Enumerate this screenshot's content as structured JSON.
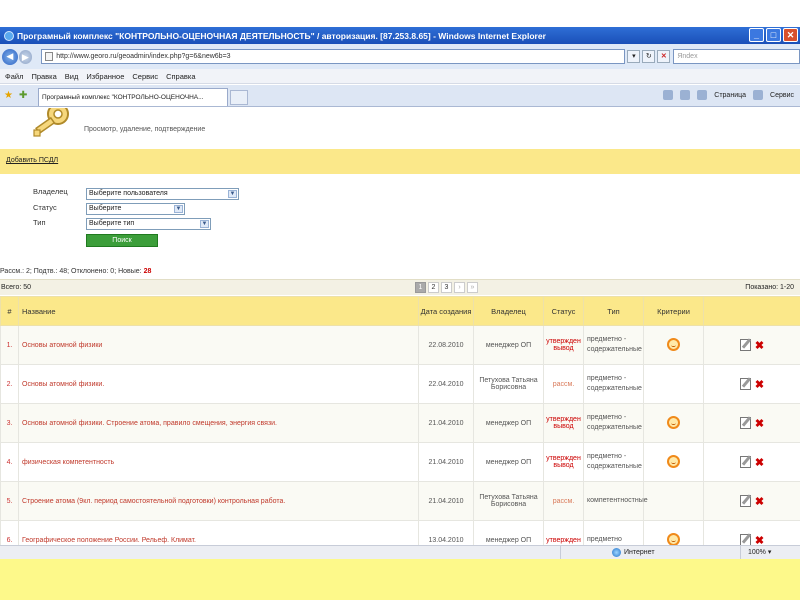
{
  "window": {
    "title": "Програмный комплекс \"КОНТРОЛЬНО-ОЦЕНОЧНАЯ ДЕЯТЕЛЬНОСТЬ\" / авторизация. [87.253.8.65] - Windows Internet Explorer",
    "minimize_label": "_",
    "maximize_label": "□",
    "close_label": "✕"
  },
  "address": {
    "url": "http://www.georo.ru/geoadmin/index.php?g=6&new6b=3",
    "search_placeholder": "Яndex",
    "go_label": "↻",
    "stop_label": "✕"
  },
  "menu": [
    "Файл",
    "Правка",
    "Вид",
    "Избранное",
    "Сервис",
    "Справка"
  ],
  "tab": {
    "label": "Програмный комплекс \"КОНТРОЛЬНО-ОЦЕНОЧНА..."
  },
  "toolbar": {
    "page_label": "Страница",
    "service_label": "Сервис"
  },
  "page": {
    "subtitle": "Просмотр, удаление, подтверждение",
    "add_link": "Добавить ПСДЛ",
    "filters": {
      "owner_label": "Владелец",
      "owner_value": "Выберите пользователя",
      "status_label": "Статус",
      "status_value": "Выберите",
      "type_label": "Тип",
      "type_value": "Выберите тип",
      "search_button": "Поиск"
    },
    "stats": {
      "text_prefix": "Рассм.: 2; Подтв.: 48; Отклонено: 0; Новые: ",
      "new_count": "28"
    },
    "total": "Всего: 50",
    "pager": {
      "pages": [
        "1",
        "2",
        "3"
      ],
      "next": "›",
      "last": "»"
    },
    "shown": "Показано: 1-20",
    "columns": {
      "num": "#",
      "name": "Название",
      "date": "Дата создания",
      "owner": "Владелец",
      "status": "Статус",
      "type": "Тип",
      "criteria": "Критерии"
    },
    "rows": [
      {
        "num": "1.",
        "name": "Основы атомной физики",
        "date": "22.08.2010",
        "owner": "менеджер ОП",
        "status": "утвержден вывод",
        "type": "предметно - содержательные"
      },
      {
        "num": "2.",
        "name": "Основы атомной физики.",
        "date": "22.04.2010",
        "owner": "Петухова Татьяна Борисовна",
        "status": "рассм.",
        "type": "предметно - содержательные"
      },
      {
        "num": "3.",
        "name": "Основы атомной физики. Строение атома, правило смещения, энергия связи.",
        "date": "21.04.2010",
        "owner": "менеджер ОП",
        "status": "утвержден вывод",
        "type": "предметно - содержательные"
      },
      {
        "num": "4.",
        "name": "физическая компетентность",
        "date": "21.04.2010",
        "owner": "менеджер ОП",
        "status": "утвержден вывод",
        "type": "предметно - содержательные"
      },
      {
        "num": "5.",
        "name": "Строение атома (9кл. период самостоятельной подготовки) контрольная работа.",
        "date": "21.04.2010",
        "owner": "Петухова Татьяна Борисовна",
        "status": "рассм.",
        "type": "компетентностные"
      },
      {
        "num": "6.",
        "name": "Географическое положение России. Рельеф. Климат.",
        "date": "13.04.2010",
        "owner": "менеджер ОП",
        "status": "утвержден",
        "type": "предметно"
      }
    ]
  },
  "statusbar": {
    "zone": "Интернет",
    "zoom": "100%"
  }
}
